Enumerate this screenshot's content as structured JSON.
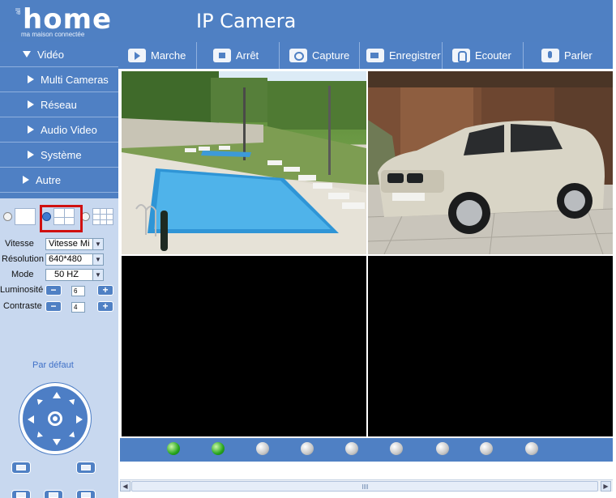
{
  "header": {
    "logo_small": "all",
    "logo_main": "home",
    "logo_sub": "ma maison connectée",
    "title": "IP Camera"
  },
  "sidebar": {
    "menu": [
      {
        "label": "Vidéo",
        "open": true
      },
      {
        "label": "Multi Cameras",
        "open": false
      },
      {
        "label": "Réseau",
        "open": false
      },
      {
        "label": "Audio Video",
        "open": false
      },
      {
        "label": "Système",
        "open": false
      },
      {
        "label": "Autre",
        "open": false
      }
    ],
    "layout_options": [
      "1 view",
      "4 views",
      "9 views"
    ],
    "selected_layout": "4 views",
    "controls": {
      "speed_label": "Vitesse",
      "speed_value": "Vitesse Mi",
      "resolution_label": "Résolution",
      "resolution_value": "640*480",
      "mode_label": "Mode",
      "mode_value": "50 HZ",
      "brightness_label": "Luminosité",
      "brightness_value": "6",
      "contrast_label": "Contraste",
      "contrast_value": "4",
      "default_link": "Par défaut"
    }
  },
  "toolbar": {
    "buttons": [
      {
        "label": "Marche",
        "icon": "play-icon"
      },
      {
        "label": "Arrêt",
        "icon": "stop-icon"
      },
      {
        "label": "Capture",
        "icon": "camera-icon"
      },
      {
        "label": "Enregistrer",
        "icon": "record-icon"
      },
      {
        "label": "Ecouter",
        "icon": "listen-icon"
      },
      {
        "label": "Parler",
        "icon": "microphone-icon"
      }
    ]
  },
  "channels": {
    "status": [
      "online",
      "online",
      "offline",
      "offline",
      "offline",
      "offline",
      "offline",
      "offline",
      "offline"
    ]
  },
  "colors": {
    "accent": "#4f80c4",
    "panel": "#c8d8ef",
    "highlight": "#d01010",
    "online": "#27a51e",
    "offline": "#c7c7c7"
  }
}
